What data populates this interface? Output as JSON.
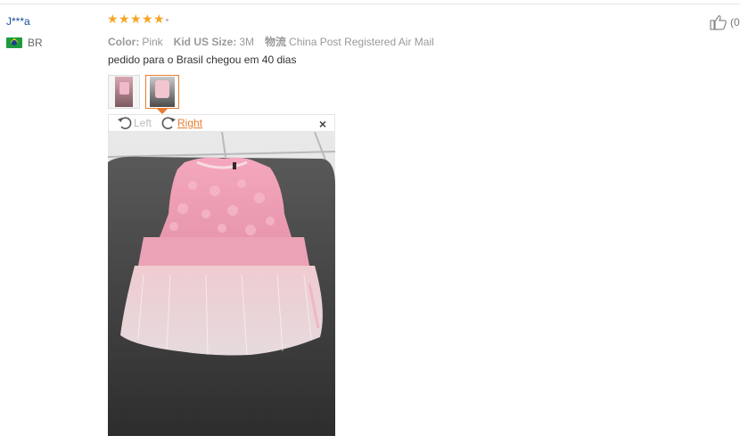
{
  "review": {
    "username": "J***a",
    "country_code": "BR",
    "rating": 5,
    "attributes": [
      {
        "key": "Color:",
        "value": "Pink"
      },
      {
        "key": "Kid US Size:",
        "value": "3M"
      },
      {
        "key": "物流",
        "value": "China Post Registered Air Mail"
      }
    ],
    "text": "pedido para o Brasil chegou em 40 dias",
    "helpful_label": "(0"
  },
  "viewer": {
    "rotate_left_label": "Left",
    "rotate_right_label": "Right",
    "close_glyph": "×",
    "selected_thumbnail": 2
  },
  "colors": {
    "star": "#f5a623",
    "accent": "#e87d2f",
    "username": "#1a4e9a",
    "muted": "#999999"
  },
  "icons": [
    "brazil-flag-icon",
    "star-icon",
    "thumbs-up-icon",
    "rotate-left-icon",
    "rotate-right-icon",
    "close-icon"
  ]
}
